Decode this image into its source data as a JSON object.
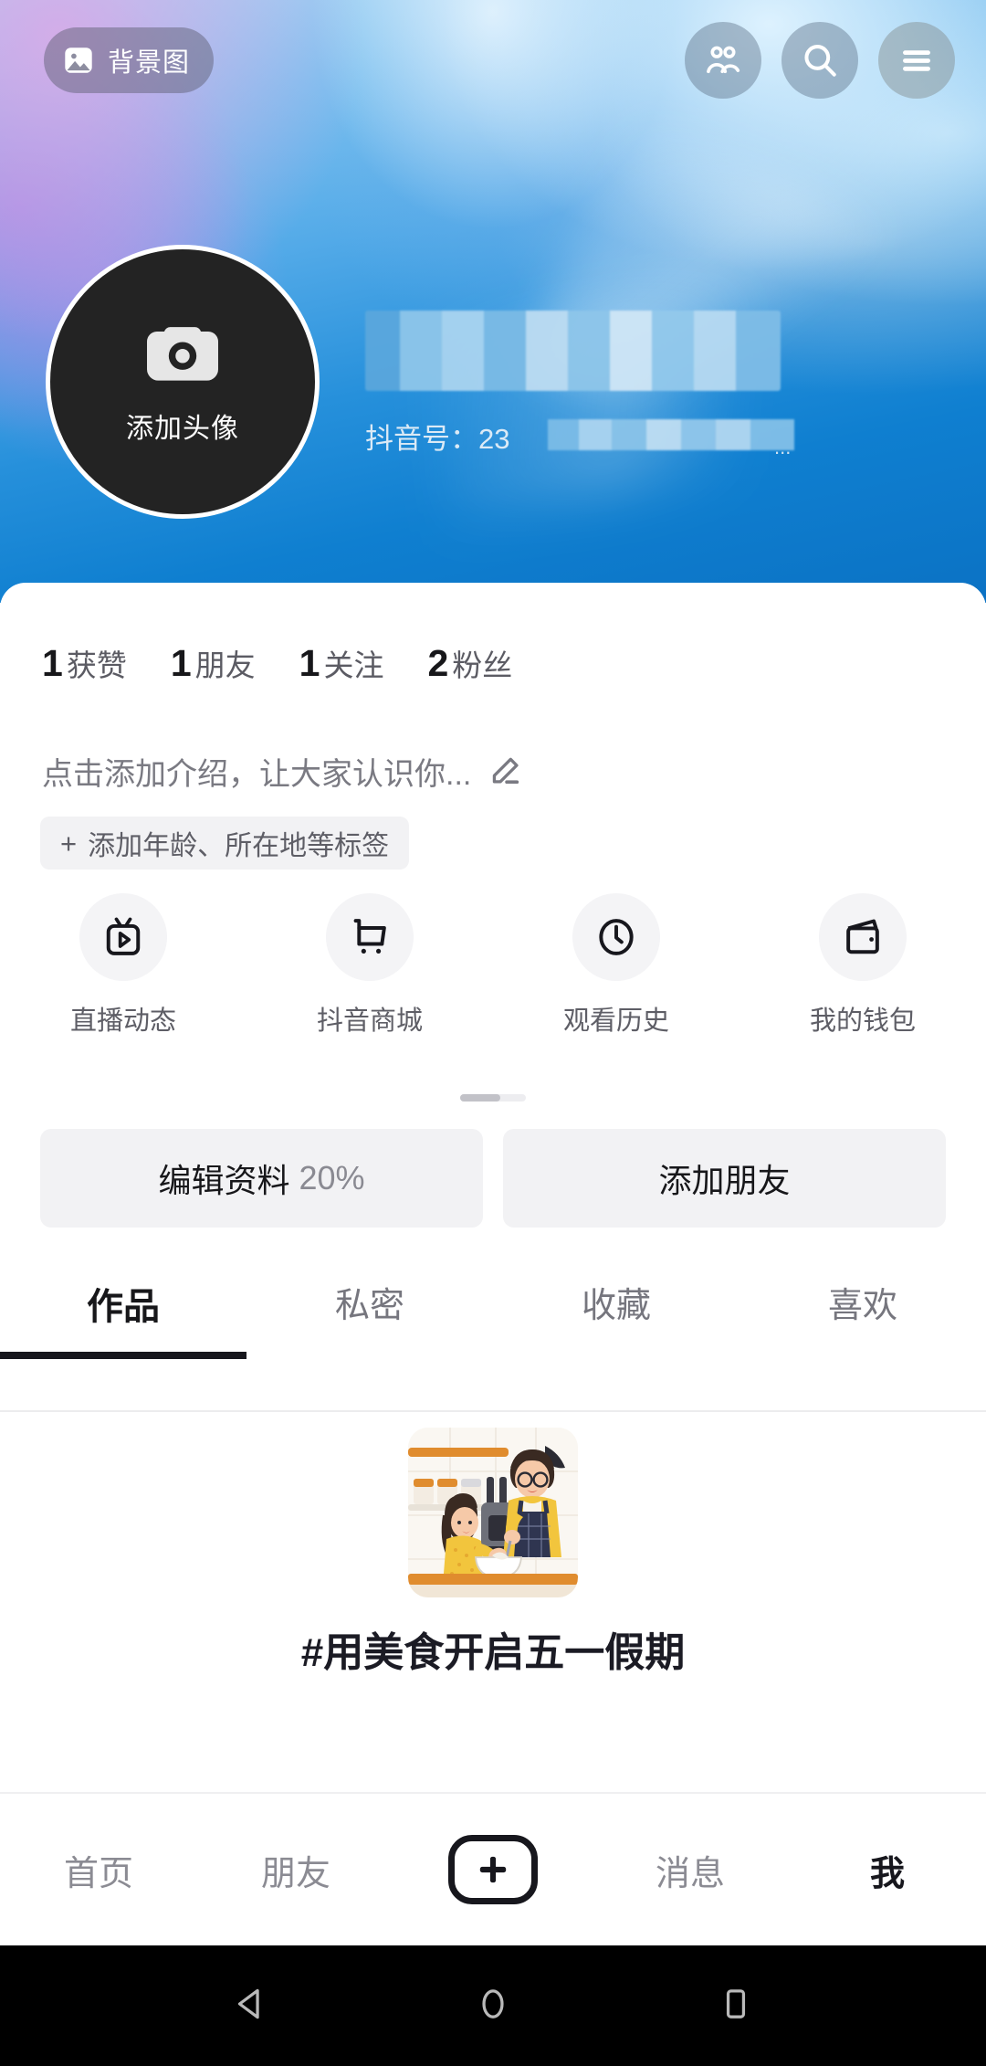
{
  "cover": {
    "chip": {
      "label": "背景图",
      "icon": "image-icon"
    },
    "buttons": [
      {
        "name": "friends",
        "icon": "people-icon"
      },
      {
        "name": "search",
        "icon": "search-icon"
      },
      {
        "name": "menu",
        "icon": "hamburger-menu-icon"
      }
    ]
  },
  "profile": {
    "avatar": {
      "label": "添加头像",
      "icon": "camera-icon"
    },
    "nickname_redacted": "",
    "douyin_id_prefix": "抖音号：",
    "douyin_id_visible": "23",
    "douyin_id_ellipsis": "..."
  },
  "stats": [
    {
      "num": "1",
      "label": "获赞"
    },
    {
      "num": "1",
      "label": "朋友"
    },
    {
      "num": "1",
      "label": "关注"
    },
    {
      "num": "2",
      "label": "粉丝"
    }
  ],
  "bio": {
    "placeholder": "点击添加介绍，让大家认识你...",
    "edit_icon": "pencil-icon",
    "tag_plus": "+",
    "tag_label": "添加年龄、所在地等标签"
  },
  "quick_actions": [
    {
      "label": "直播动态",
      "icon": "live-tv-icon"
    },
    {
      "label": "抖音商城",
      "icon": "shopping-cart-icon"
    },
    {
      "label": "观看历史",
      "icon": "clock-icon"
    },
    {
      "label": "我的钱包",
      "icon": "wallet-icon"
    }
  ],
  "action_buttons": {
    "edit_profile": "编辑资料",
    "edit_profile_percent": "20%",
    "add_friend": "添加朋友"
  },
  "tabs": [
    {
      "label": "作品",
      "active": true
    },
    {
      "label": "私密",
      "active": false
    },
    {
      "label": "收藏",
      "active": false
    },
    {
      "label": "喜欢",
      "active": false
    }
  ],
  "empty_state": {
    "illustration": "cooking-couple-illustration",
    "title": "#用美食开启五一假期"
  },
  "bottom_nav": [
    {
      "label": "首页",
      "active": false
    },
    {
      "label": "朋友",
      "active": false
    },
    {
      "label": "",
      "icon": "plus-icon",
      "active": false
    },
    {
      "label": "消息",
      "active": false
    },
    {
      "label": "我",
      "active": true
    }
  ],
  "system_bar": [
    {
      "icon": "back-triangle-icon"
    },
    {
      "icon": "home-circle-icon"
    },
    {
      "icon": "recents-square-icon"
    }
  ],
  "colors": {
    "cover_blue": "#0b72c4",
    "accent_dark": "#17171d",
    "chip_bg": "#f2f2f4",
    "muted_text": "#76767e"
  }
}
